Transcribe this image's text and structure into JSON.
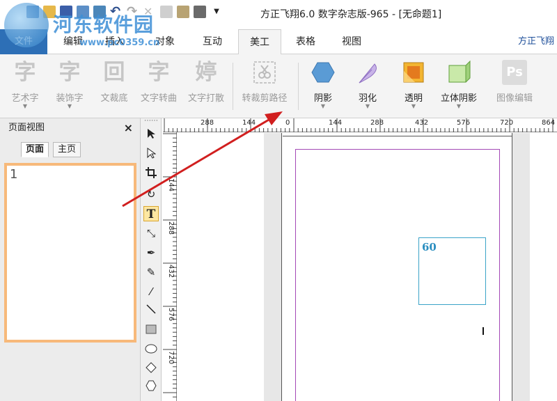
{
  "window": {
    "title": "方正飞翔6.0 数字杂志版-965 - [无命题1]"
  },
  "watermark": {
    "title": "河东软件园",
    "url": "www.pc0359.cn"
  },
  "ribbon_tabs": [
    {
      "label": "文件"
    },
    {
      "label": "编辑"
    },
    {
      "label": "插入"
    },
    {
      "label": "对象"
    },
    {
      "label": "互动"
    },
    {
      "label": "美工"
    },
    {
      "label": "表格"
    },
    {
      "label": "视图"
    }
  ],
  "brand": "方正飞翔",
  "ribbon_buttons": [
    {
      "label": "艺术字",
      "icon": "字"
    },
    {
      "label": "装饰字",
      "icon": "字"
    },
    {
      "label": "文裁底",
      "icon": "回"
    },
    {
      "label": "文字转曲",
      "icon": "字"
    },
    {
      "label": "文字打散",
      "icon": "婷"
    },
    {
      "label": "转裁剪路径",
      "icon": "scissors-icon"
    },
    {
      "label": "阴影",
      "icon": "hexagon-icon"
    },
    {
      "label": "羽化",
      "icon": "feather-icon"
    },
    {
      "label": "透明",
      "icon": "transparency-icon"
    },
    {
      "label": "立体阴影",
      "icon": "3d-shadow-icon"
    },
    {
      "label": "图像编辑",
      "icon": "Ps"
    }
  ],
  "panel": {
    "title": "页面视图",
    "close": "×",
    "tabs": [
      {
        "label": "页面"
      },
      {
        "label": "主页"
      }
    ],
    "page_number": "1"
  },
  "tools": [
    "select-arrow-icon",
    "direct-select-icon",
    "crop-icon",
    "rotate-icon",
    "text-icon",
    "text-path-icon",
    "pen-icon",
    "pen-add-icon",
    "eyedropper-icon",
    "line-icon",
    "rectangle-icon",
    "ellipse-icon",
    "diamond-icon",
    "polygon-icon"
  ],
  "tool_glyphs": {
    "text": "T"
  },
  "ruler": {
    "h_labels": [
      "288",
      "144",
      "0",
      "144",
      "288",
      "432",
      "576",
      "720",
      "864"
    ],
    "v_labels": [
      "144",
      "288",
      "432",
      "576",
      "720"
    ]
  },
  "canvas": {
    "textbox_label": "60"
  },
  "colors": {
    "file_tab": "#2d6fb6",
    "thumb_border": "#f7b97a",
    "margin_guide": "#a348b6",
    "textbox": "#3aa3c8",
    "arrow": "#d11f1f"
  }
}
